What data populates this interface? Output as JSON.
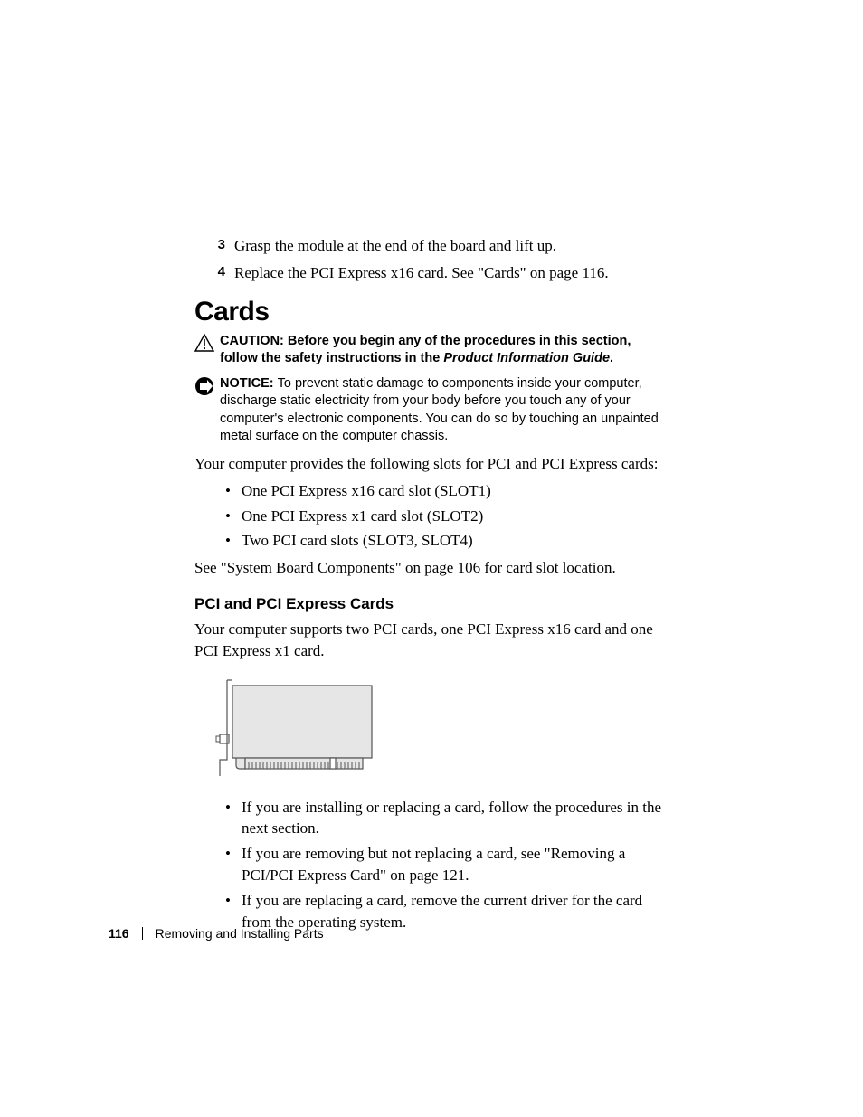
{
  "steps": [
    {
      "num": "3",
      "text": "Grasp the module at the end of the board and lift up."
    },
    {
      "num": "4",
      "text": "Replace the PCI Express x16 card. See \"Cards\" on page 116."
    }
  ],
  "section_heading": "Cards",
  "caution": {
    "label": "CAUTION: ",
    "pre": "Before you begin any of the procedures in this section, follow the safety instructions in the ",
    "guide": "Product Information Guide",
    "post": "."
  },
  "notice": {
    "label": "NOTICE: ",
    "text": "To prevent static damage to components inside your computer, discharge static electricity from your body before you touch any of your computer's electronic components. You can do so by touching an unpainted metal surface on the computer chassis."
  },
  "intro_para": "Your computer provides the following slots for PCI and PCI Express cards:",
  "slot_bullets": [
    "One PCI Express x16 card slot (SLOT1)",
    "One PCI Express x1 card slot (SLOT2)",
    "Two PCI card slots (SLOT3, SLOT4)"
  ],
  "see_para": "See \"System Board Components\" on page 106 for card slot location.",
  "subsection_heading": "PCI and PCI Express Cards",
  "support_para": "Your computer supports two PCI cards, one PCI Express x16 card and one PCI Express x1 card.",
  "action_bullets": [
    "If you are installing or replacing a card, follow the procedures in the next section.",
    "If you are removing but not replacing a card, see \"Removing a PCI/PCI Express Card\" on page 121.",
    "If you are replacing a card, remove the current driver for the card from the operating system."
  ],
  "footer": {
    "page_num": "116",
    "chapter": "Removing and Installing Parts"
  }
}
